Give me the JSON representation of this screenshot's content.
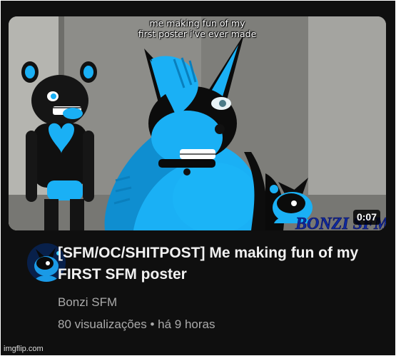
{
  "video": {
    "thumbnail_caption": "me making fun of my\nfirst poster i've ever made",
    "thumbnail_brand_text": "BONZI SFM",
    "duration": "0:07",
    "title": "[SFM/OC/SHITPOST] Me making fun of my FIRST SFM poster",
    "channel": "Bonzi SFM",
    "views": "80 visualizações",
    "separator": "•",
    "age": "há 9 horas"
  },
  "watermark": "imgflip.com",
  "colors": {
    "background": "#0f0f0f",
    "title": "#f1f1f1",
    "secondary_text": "#aaaaaa",
    "character_blue": "#1ab0f5"
  },
  "icons": {
    "avatar": "channel-avatar-blue-wolf"
  }
}
